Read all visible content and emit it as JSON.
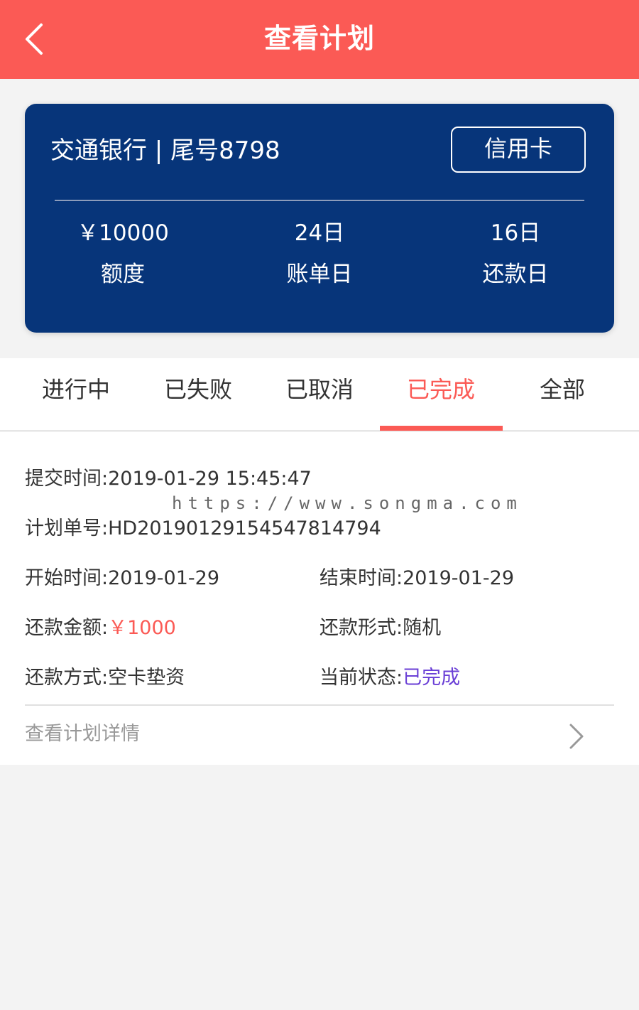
{
  "header": {
    "title": "查看计划",
    "back_icon": "chevron-left-icon"
  },
  "card": {
    "bank_line": "交通银行 | 尾号8798",
    "card_type": "信用卡",
    "stats": [
      {
        "value": "￥10000",
        "label": "额度"
      },
      {
        "value": "24日",
        "label": "账单日"
      },
      {
        "value": "16日",
        "label": "还款日"
      }
    ],
    "background_color": "#07357a"
  },
  "tabs": {
    "items": [
      "进行中",
      "已失败",
      "已取消",
      "已完成",
      "全部"
    ],
    "active": "已完成"
  },
  "plan": {
    "submit_time": "提交时间:2019-01-29 15:45:47",
    "watermark": "https://www.songma.com",
    "plan_no": "计划单号:HD20190129154547814794",
    "start_time": "开始时间:2019-01-29",
    "end_time": "结束时间:2019-01-29",
    "amount_label": "还款金额:",
    "amount_value": "￥1000",
    "form": "还款形式:随机",
    "method": "还款方式:空卡垫资",
    "status_label": "当前状态:",
    "status_value": "已完成",
    "detail_link": "查看计划详情",
    "detail_icon": "chevron-right-icon"
  },
  "colors": {
    "accent": "#fb5a55",
    "status": "#6a3fd6"
  }
}
